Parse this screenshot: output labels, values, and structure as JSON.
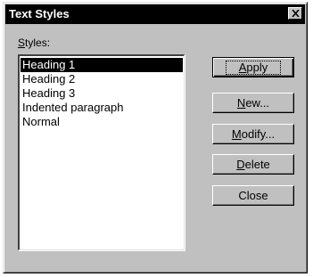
{
  "dialog": {
    "title": "Text Styles",
    "close_symbol": "×"
  },
  "styles": {
    "label_mnemonic": "S",
    "label_rest": "tyles:",
    "items": [
      {
        "label": "Heading 1",
        "selected": true
      },
      {
        "label": "Heading 2",
        "selected": false
      },
      {
        "label": "Heading 3",
        "selected": false
      },
      {
        "label": "Indented paragraph",
        "selected": false
      },
      {
        "label": "Normal",
        "selected": false
      }
    ]
  },
  "buttons": {
    "apply": {
      "mnemonic": "A",
      "rest": "pply"
    },
    "new": {
      "mnemonic": "N",
      "rest": "ew..."
    },
    "modify": {
      "mnemonic": "M",
      "rest": "odify..."
    },
    "delete": {
      "mnemonic": "D",
      "rest": "elete"
    },
    "close": {
      "label": "Close"
    }
  },
  "colors": {
    "dialog_face": "#c0c0c0",
    "titlebar": "#000000",
    "selection": "#000000"
  }
}
